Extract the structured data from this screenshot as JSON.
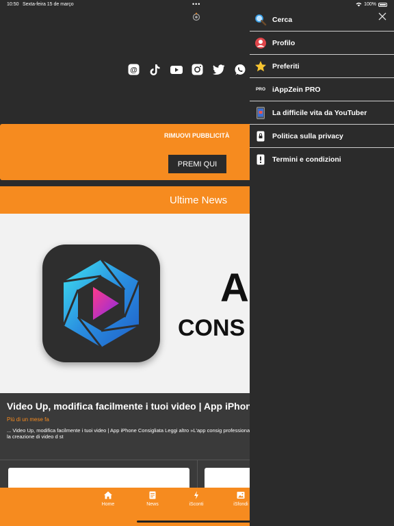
{
  "status_bar": {
    "time": "10:50",
    "date": "Sexta-feira 15 de março",
    "dots": "•••",
    "battery": "100%"
  },
  "promo": {
    "title": "RIMUOVI PUBBLICITÀ",
    "button": "PREMI QUI"
  },
  "news_header": "Ultime News",
  "hero": {
    "line1": "A",
    "line2": "CONS"
  },
  "article": {
    "title": "Video Up, modifica facilmente i tuoi video | App iPhone C",
    "time": "Più di un mese fa",
    "excerpt": "... Video Up, modifica facilmente i tuoi video | App iPhone Consigliata Leggi altro »L'app consig professionalmente video presenti sul tuo iPhone o iPad.Video Up! rende la creazione di video d st"
  },
  "tabs": [
    {
      "label": "Home",
      "icon": "home-icon"
    },
    {
      "label": "News",
      "icon": "news-icon"
    },
    {
      "label": "iSconti",
      "icon": "lightning-icon"
    },
    {
      "label": "iSfondi",
      "icon": "image-icon"
    }
  ],
  "socials": [
    "threads-icon",
    "tiktok-icon",
    "youtube-icon",
    "instagram-icon",
    "twitter-icon",
    "whatsapp-icon"
  ],
  "menu": [
    {
      "label": "Cerca",
      "icon": "search-icon"
    },
    {
      "label": "Profilo",
      "icon": "profile-icon"
    },
    {
      "label": "Preferiti",
      "icon": "star-icon"
    },
    {
      "label": "iAppZein PRO",
      "icon": "pro-icon",
      "tag": "PRO"
    },
    {
      "label": "La difficile vita da YouTuber",
      "icon": "phone-icon"
    },
    {
      "label": "Politica sulla privacy",
      "icon": "privacy-icon"
    },
    {
      "label": "Termini e condizioni",
      "icon": "terms-icon"
    }
  ],
  "colors": {
    "accent": "#f68b1f",
    "background": "#2b2b2b"
  }
}
